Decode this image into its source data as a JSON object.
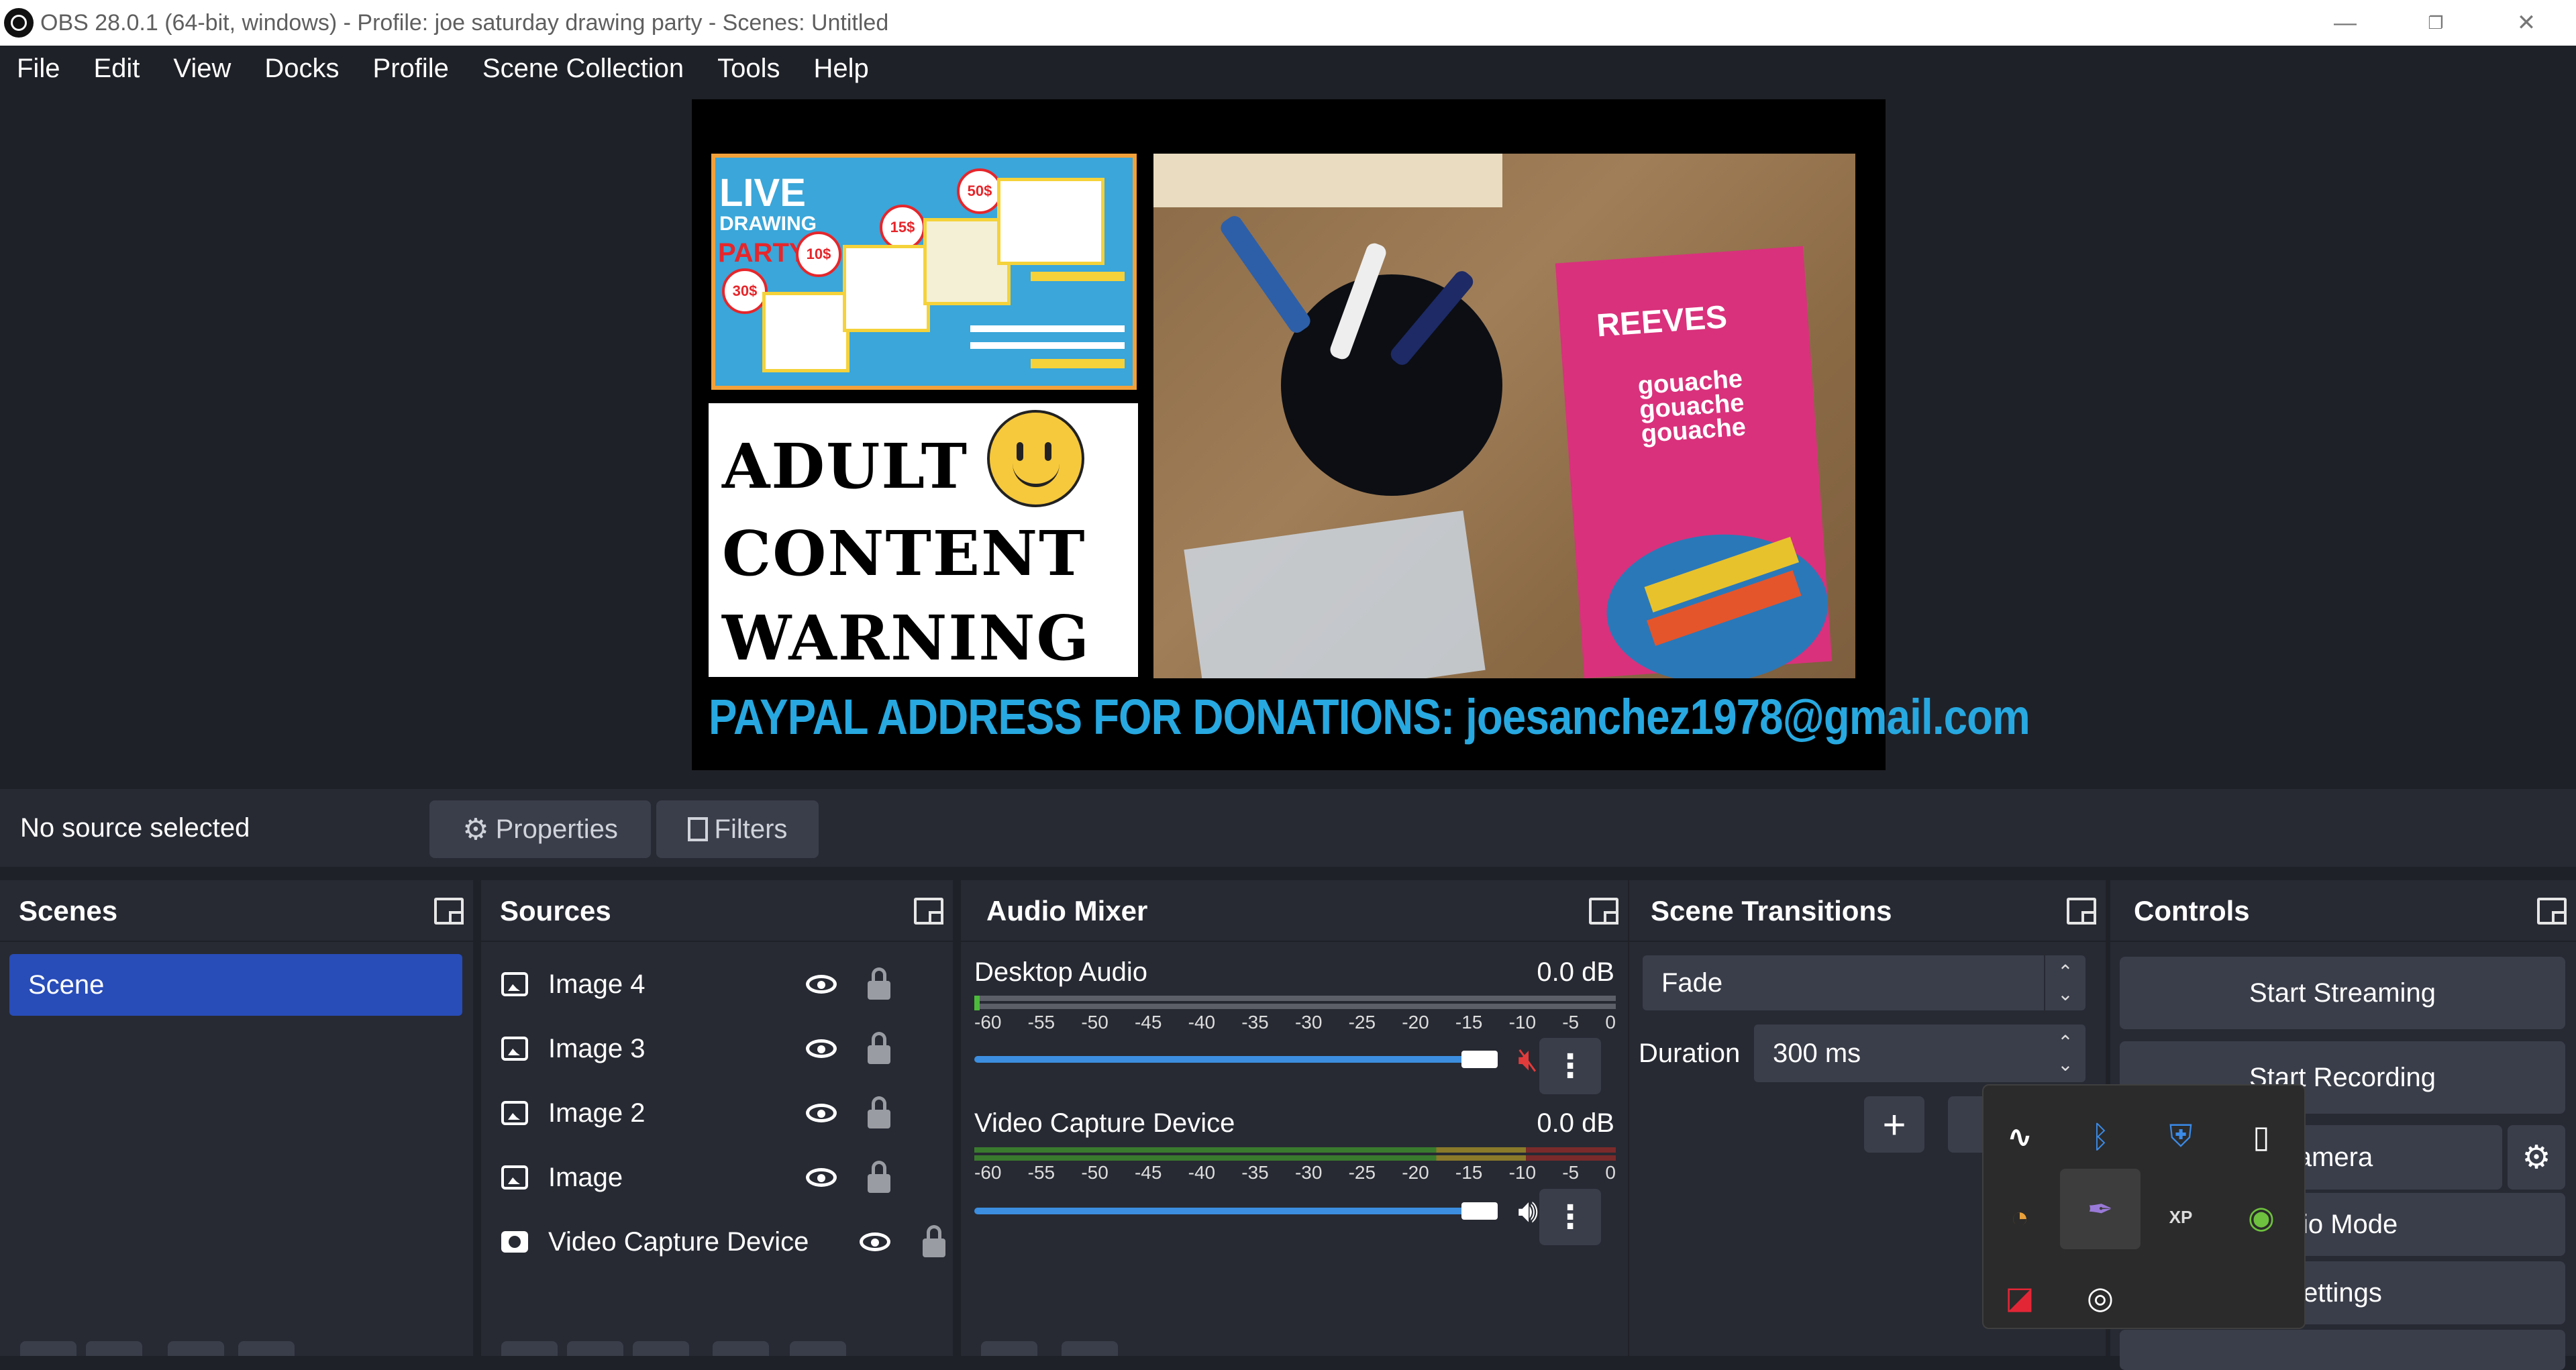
{
  "window": {
    "title": "OBS 28.0.1 (64-bit, windows) - Profile: joe saturday drawing party - Scenes: Untitled",
    "minimize": "—",
    "maximize": "❐",
    "close": "✕"
  },
  "menu": [
    "File",
    "Edit",
    "View",
    "Docks",
    "Profile",
    "Scene Collection",
    "Tools",
    "Help"
  ],
  "preview": {
    "warning_lines": [
      "ADULT",
      "CONTENT",
      "WARNING"
    ],
    "flyer_text": {
      "live": "LIVE",
      "drawing": "DRAWING",
      "party": "PARTY!",
      "price_30": "30$",
      "price_10": "10$",
      "price_15": "15$",
      "price_50": "50$"
    },
    "webcam_box_brand": "REEVES",
    "webcam_box_words": [
      "gouache",
      "gouache",
      "gouache"
    ],
    "donation_text": "PAYPAL ADDRESS FOR DONATIONS: joesanchez1978@gmail.com"
  },
  "source_bar": {
    "status": "No source selected",
    "properties_label": "Properties",
    "filters_label": "Filters"
  },
  "scenes": {
    "title": "Scenes",
    "items": [
      "Scene"
    ]
  },
  "sources": {
    "title": "Sources",
    "items": [
      {
        "label": "Image 4",
        "type": "image"
      },
      {
        "label": "Image 3",
        "type": "image"
      },
      {
        "label": "Image 2",
        "type": "image"
      },
      {
        "label": "Image",
        "type": "image"
      },
      {
        "label": "Video Capture Device",
        "type": "camera"
      }
    ]
  },
  "audio_mixer": {
    "title": "Audio Mixer",
    "ticks": [
      "-60",
      "-55",
      "-50",
      "-45",
      "-40",
      "-35",
      "-30",
      "-25",
      "-20",
      "-15",
      "-10",
      "-5",
      "0"
    ],
    "channels": [
      {
        "name": "Desktop Audio",
        "db": "0.0 dB",
        "muted": true
      },
      {
        "name": "Video Capture Device",
        "db": "0.0 dB",
        "muted": false
      }
    ]
  },
  "transitions": {
    "title": "Scene Transitions",
    "selected": "Fade",
    "duration_label": "Duration",
    "duration_value": "300 ms",
    "add": "+"
  },
  "controls": {
    "title": "Controls",
    "start_streaming": "Start Streaming",
    "start_recording": "Start Recording",
    "virtual_camera": "al Camera",
    "studio_mode": "dio Mode",
    "settings": "ettings"
  },
  "tray_icons": [
    "tilde-app-icon",
    "bluetooth-icon",
    "security-warning-icon",
    "usb-drive-icon",
    "shield-app-icon",
    "pen-app-icon",
    "xp-pen-icon",
    "utorrent-icon",
    "amd-icon",
    "obs-icon"
  ],
  "colors": {
    "selection": "#284cb8",
    "panel": "#272a33",
    "background": "#1f2128",
    "button": "#3a3e4a"
  }
}
